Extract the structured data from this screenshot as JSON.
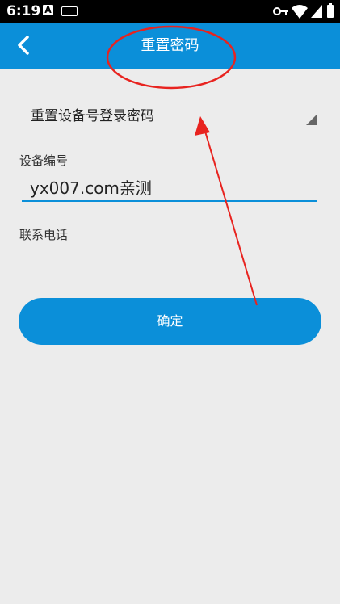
{
  "status_bar": {
    "time": "6:19",
    "a_badge": "A"
  },
  "app_bar": {
    "title": "重置密码",
    "back_icon": "chevron-left-icon"
  },
  "reset_type": {
    "value": "重置设备号登录密码",
    "arrow_icon": "dropdown-arrow-icon"
  },
  "device_number": {
    "label": "设备编号",
    "value": "yx007.com亲测"
  },
  "phone": {
    "label": "联系电话",
    "value": ""
  },
  "confirm_button": {
    "label": "确定"
  },
  "colors": {
    "primary": "#0b8fd9",
    "background": "#ececec",
    "annotation": "#e8231f"
  }
}
